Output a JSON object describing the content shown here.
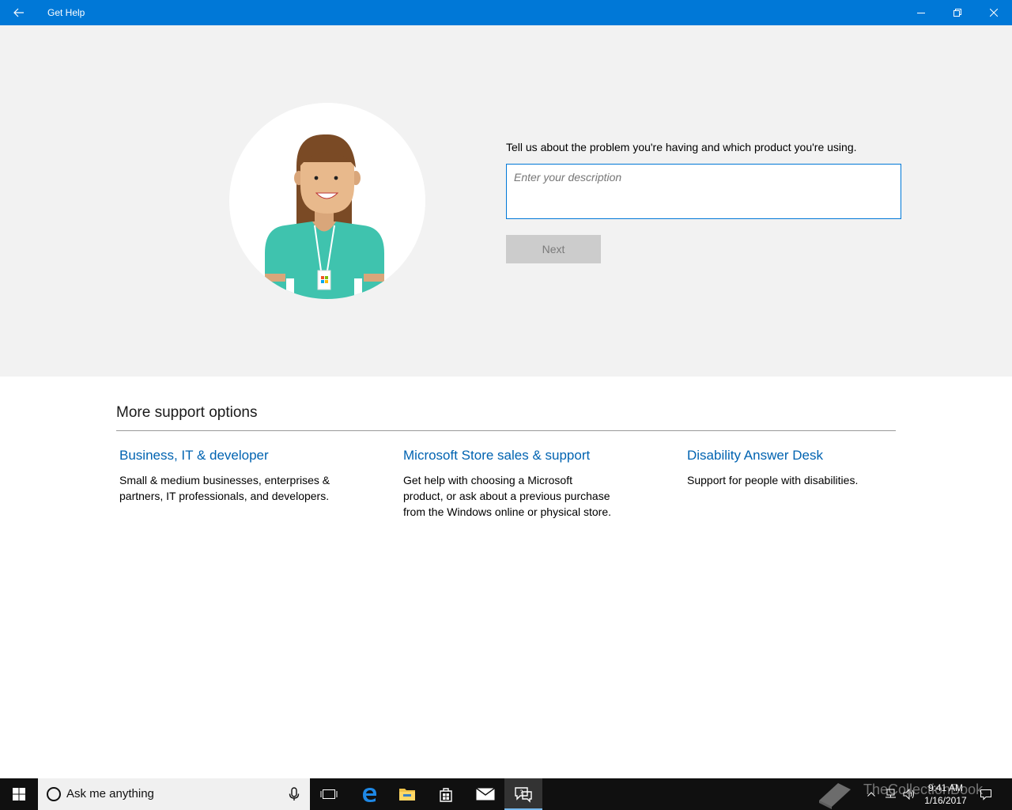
{
  "window": {
    "title": "Get Help",
    "accent_color": "#0078d7"
  },
  "hero": {
    "prompt": "Tell us about the problem you're having and which product you're using.",
    "description_placeholder": "Enter your description",
    "description_value": "",
    "next_label": "Next",
    "avatar_icon": "support-agent-illustration"
  },
  "more_support": {
    "title": "More support options",
    "options": [
      {
        "title": "Business, IT & developer",
        "description": "Small & medium businesses, enterprises & partners, IT professionals, and developers."
      },
      {
        "title": "Microsoft Store sales & support",
        "description": "Get help with choosing a Microsoft product, or ask about a previous purchase from the Windows online or physical store."
      },
      {
        "title": "Disability Answer Desk",
        "description": "Support for people with disabilities."
      }
    ],
    "link_color": "#0063b1"
  },
  "taskbar": {
    "search_placeholder": "Ask me anything",
    "apps": [
      "task-view-icon",
      "edge-icon",
      "file-explorer-icon",
      "store-icon",
      "mail-icon",
      "get-help-icon"
    ],
    "active_app": "get-help-icon",
    "time": "9:41 AM",
    "date": "1/16/2017",
    "watermark": "TheCollectionBook"
  }
}
